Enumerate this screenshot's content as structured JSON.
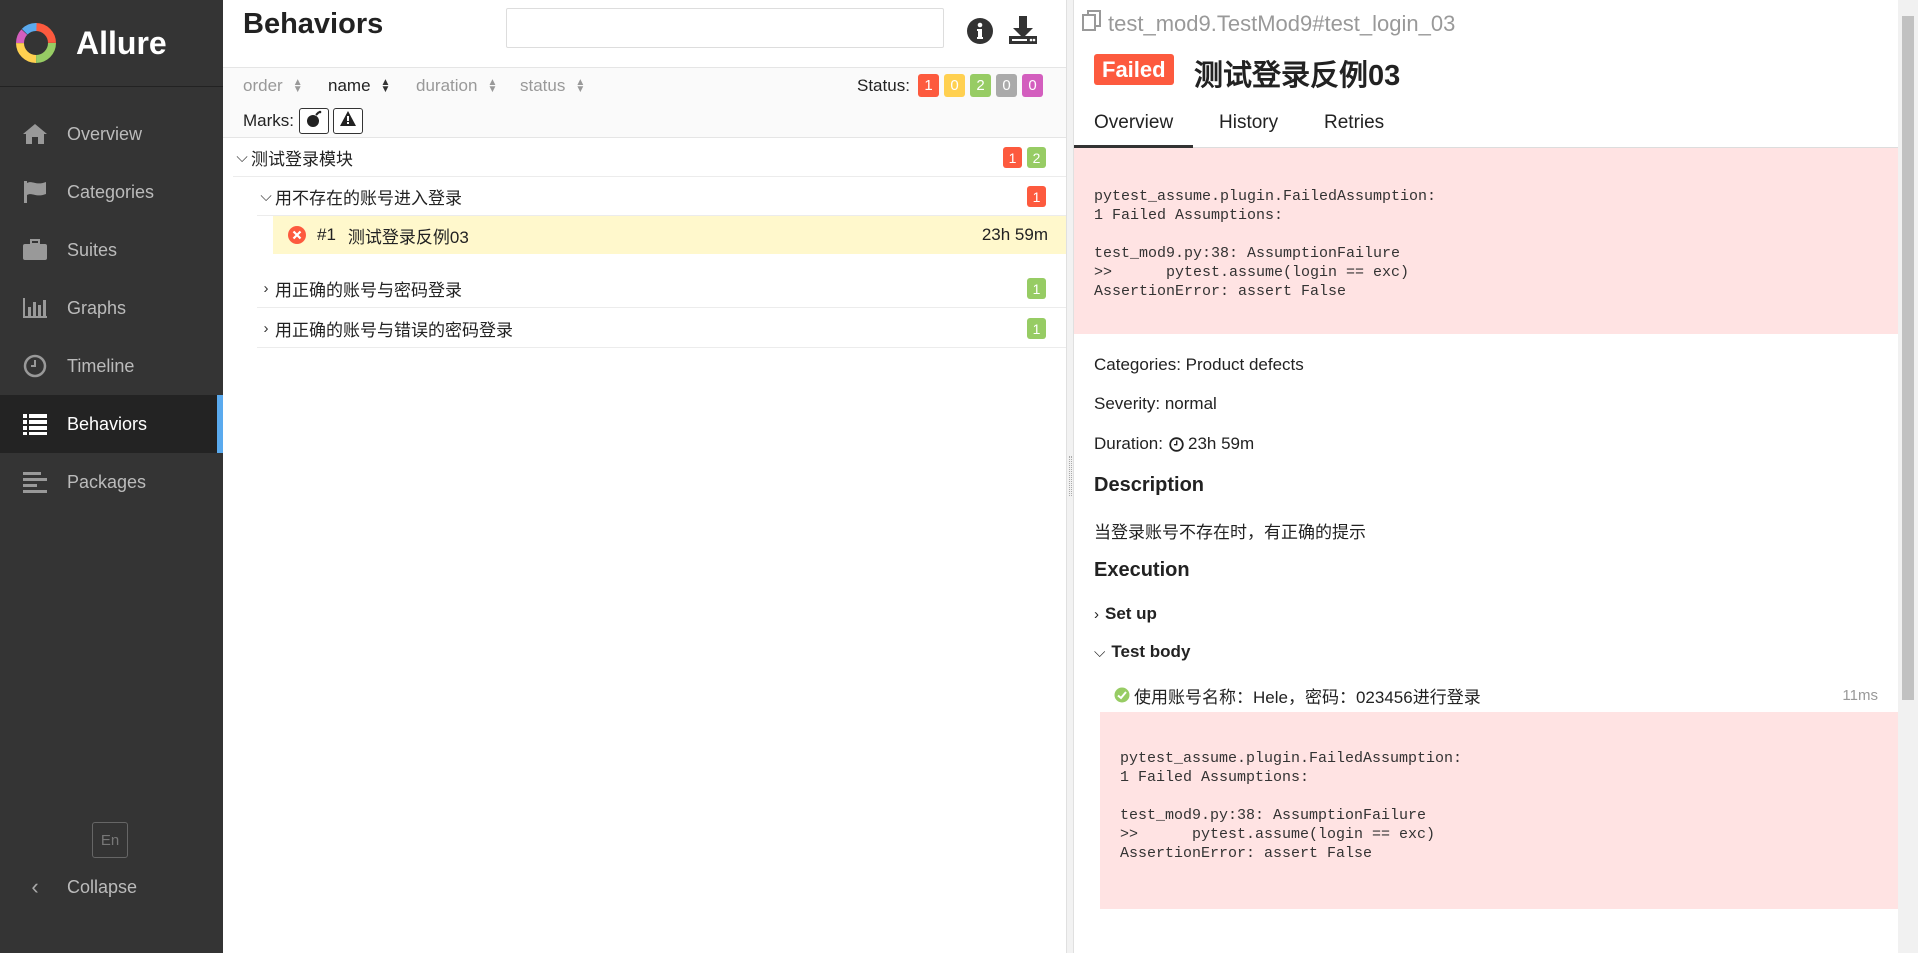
{
  "app": {
    "name": "Allure"
  },
  "sidebar": {
    "items": [
      {
        "label": "Overview",
        "icon": "home-icon"
      },
      {
        "label": "Categories",
        "icon": "flag-icon"
      },
      {
        "label": "Suites",
        "icon": "briefcase-icon"
      },
      {
        "label": "Graphs",
        "icon": "bar-chart-icon"
      },
      {
        "label": "Timeline",
        "icon": "clock-icon"
      },
      {
        "label": "Behaviors",
        "icon": "list-icon",
        "active": true
      },
      {
        "label": "Packages",
        "icon": "align-left-icon"
      }
    ],
    "language": "En",
    "collapse": "Collapse"
  },
  "tree": {
    "title": "Behaviors",
    "search": {
      "value": "",
      "placeholder": ""
    },
    "sort": {
      "order": "order",
      "name": "name",
      "duration": "duration",
      "status": "status"
    },
    "status_label": "Status:",
    "status_counts": {
      "failed": "1",
      "broken": "0",
      "passed": "2",
      "skipped": "0",
      "unknown": "0"
    },
    "marks_label": "Marks:",
    "epic": {
      "label": "测试登录模块",
      "failed": "1",
      "passed": "2"
    },
    "features": [
      {
        "label": "用不存在的账号进入登录",
        "count": "1",
        "status": "failed",
        "expanded": true
      },
      {
        "label": "用正确的账号与密码登录",
        "count": "1",
        "status": "passed",
        "expanded": false
      },
      {
        "label": "用正确的账号与错误的密码登录",
        "count": "1",
        "status": "passed",
        "expanded": false
      }
    ],
    "test": {
      "num": "#1",
      "name": "测试登录反例03",
      "duration": "23h 59m"
    }
  },
  "detail": {
    "path": "test_mod9.TestMod9#test_login_03",
    "status": "Failed",
    "title": "测试登录反例03",
    "tabs": [
      "Overview",
      "History",
      "Retries"
    ],
    "error": "pytest_assume.plugin.FailedAssumption:\n1 Failed Assumptions:\n\ntest_mod9.py:38: AssumptionFailure\n>>      pytest.assume(login == exc)\nAssertionError: assert False",
    "categories": "Categories: Product defects",
    "severity": "Severity: normal",
    "duration_label": "Duration:",
    "duration": "23h 59m",
    "description_h": "Description",
    "description": "当登录账号不存在时，有正确的提示",
    "execution_h": "Execution",
    "setup": "Set up",
    "body": "Test body",
    "step": {
      "name": "使用账号名称：Hele，密码：023456进行登录",
      "time": "11ms"
    },
    "step_error": "pytest_assume.plugin.FailedAssumption:\n1 Failed Assumptions:\n\ntest_mod9.py:38: AssumptionFailure\n>>      pytest.assume(login == exc)\nAssertionError: assert False"
  },
  "colors": {
    "failed": "#fd5a3e",
    "passed": "#97cc64",
    "broken": "#ffd050",
    "skipped": "#aaaaaa",
    "unknown": "#d35ebe",
    "accent": "#5aaaee"
  }
}
